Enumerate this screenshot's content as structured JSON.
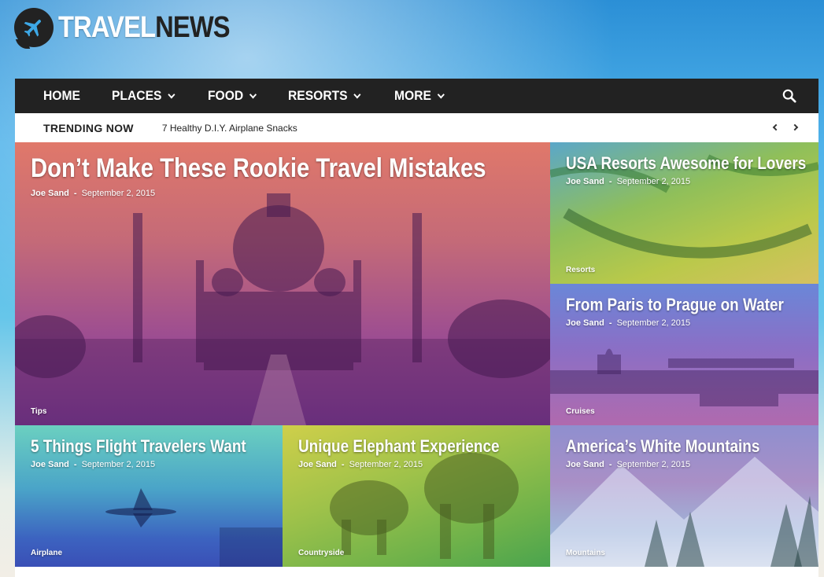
{
  "logo": {
    "word1": "TRAVEL",
    "word2": "NEWS",
    "icon": "airplane-icon"
  },
  "nav": {
    "items": [
      {
        "label": "HOME",
        "dropdown": false
      },
      {
        "label": "PLACES",
        "dropdown": true
      },
      {
        "label": "FOOD",
        "dropdown": true
      },
      {
        "label": "RESORTS",
        "dropdown": true
      },
      {
        "label": "MORE",
        "dropdown": true
      }
    ],
    "search_icon": "search-icon"
  },
  "trending": {
    "label": "TRENDING NOW",
    "headline": "7 Healthy D.I.Y. Airplane Snacks"
  },
  "tiles": [
    {
      "title": "Don’t Make These Rookie Travel Mistakes",
      "author": "Joe Sand",
      "date": "September 2, 2015",
      "category": "Tips"
    },
    {
      "title": "USA Resorts Awesome for Lovers",
      "author": "Joe Sand",
      "date": "September 2, 2015",
      "category": "Resorts"
    },
    {
      "title": "From Paris to Prague on Water",
      "author": "Joe Sand",
      "date": "September 2, 2015",
      "category": "Cruises"
    },
    {
      "title": "5 Things Flight Travelers Want",
      "author": "Joe Sand",
      "date": "September 2, 2015",
      "category": "Airplane"
    },
    {
      "title": "Unique Elephant Experience",
      "author": "Joe Sand",
      "date": "September 2, 2015",
      "category": "Countryside"
    },
    {
      "title": "America’s White Mountains",
      "author": "Joe Sand",
      "date": "September 2, 2015",
      "category": "Mountains"
    }
  ],
  "meta_separator": "-",
  "colors": {
    "nav_bg": "#222222",
    "accent": "#ffffff"
  }
}
